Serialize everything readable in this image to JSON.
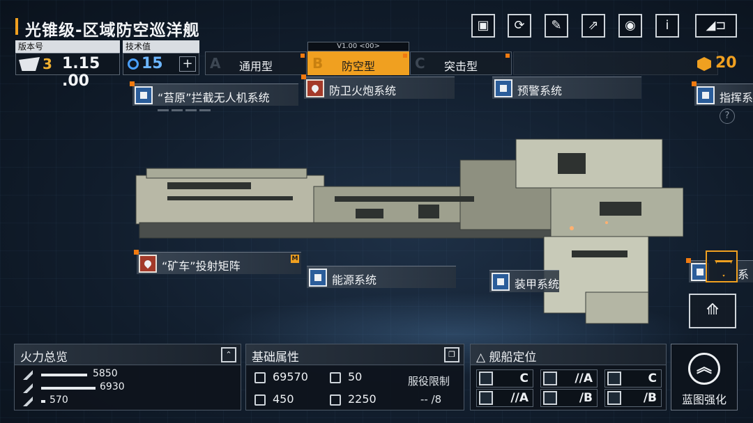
{
  "title": "光锥级-区域防空巡洋舰",
  "version": {
    "label": "版本号",
    "stars": "3",
    "number": "1.15 .00"
  },
  "tech": {
    "label": "技术值",
    "value": "15",
    "plus": "+"
  },
  "version_tag": "V1.00 <00>",
  "types": [
    {
      "letter": "A",
      "label": "通用型"
    },
    {
      "letter": "B",
      "label": "防空型"
    },
    {
      "letter": "C",
      "label": "突击型"
    }
  ],
  "currency": "20",
  "top_buttons": [
    {
      "icon": "blueprint-icon",
      "glyph": "▣"
    },
    {
      "icon": "refresh-icon",
      "glyph": "⟳"
    },
    {
      "icon": "paint-icon",
      "glyph": "✎"
    },
    {
      "icon": "share-icon",
      "glyph": "⇗"
    },
    {
      "icon": "view-icon",
      "glyph": "◉"
    },
    {
      "icon": "info-icon",
      "glyph": "i"
    }
  ],
  "back_glyph": "◢⊐",
  "systems": {
    "interceptor": "“苔原”拦截无人机系统",
    "flak": "防卫火炮系统",
    "warning": "预警系统",
    "command": "指挥系",
    "railgun": "“矿车”投射矩阵",
    "railgun_tag": "M",
    "energy": "能源系统",
    "armor": "装甲系统",
    "right_partial": "系"
  },
  "help": "?",
  "firepower": {
    "title": "火力总览",
    "rows": [
      {
        "value": "5850",
        "fill": 0.22
      },
      {
        "value": "6930",
        "fill": 0.26
      },
      {
        "value": "570",
        "fill": 0.02
      }
    ]
  },
  "attributes": {
    "title": "基础属性",
    "hp": "69570",
    "armor": "50",
    "speed": "450",
    "range": "2250",
    "service_label": "服役限制",
    "service_value": "-- /8"
  },
  "positioning": {
    "title": "舰船定位",
    "grades": [
      "C",
      "//A",
      "C",
      "//A",
      "/B",
      "/B"
    ]
  },
  "enhance": {
    "label": "蓝图强化",
    "glyph": "︽"
  }
}
